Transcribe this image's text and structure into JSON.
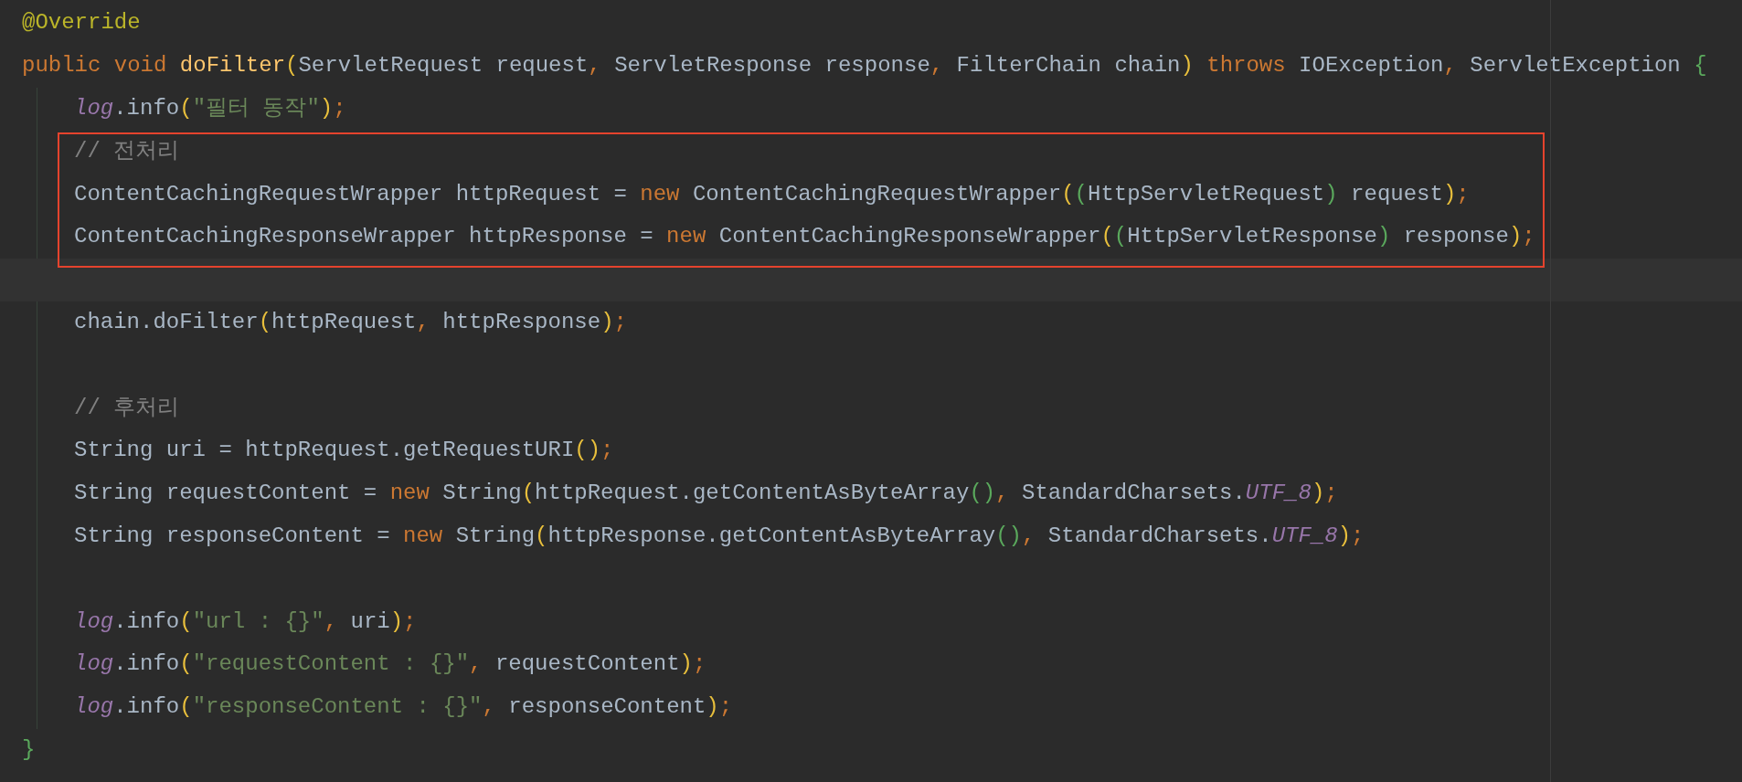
{
  "editor": {
    "lines": [
      {
        "kind": "line",
        "tokens": [
          {
            "kind": "annotation",
            "text": "@Override"
          }
        ]
      },
      {
        "kind": "line",
        "tokens": [
          {
            "kind": "keyword",
            "text": "public void "
          },
          {
            "kind": "method",
            "text": "doFilter"
          },
          {
            "kind": "bracket1",
            "text": "("
          },
          {
            "kind": "plain",
            "text": "ServletRequest request"
          },
          {
            "kind": "punct",
            "text": ", "
          },
          {
            "kind": "plain",
            "text": "ServletResponse response"
          },
          {
            "kind": "punct",
            "text": ", "
          },
          {
            "kind": "plain",
            "text": "FilterChain chain"
          },
          {
            "kind": "bracket1",
            "text": ")"
          },
          {
            "kind": "keyword",
            "text": " throws"
          },
          {
            "kind": "plain",
            "text": " IOException"
          },
          {
            "kind": "punct",
            "text": ", "
          },
          {
            "kind": "plain",
            "text": "ServletException "
          },
          {
            "kind": "bracket2",
            "text": "{"
          }
        ],
        "children": [
          {
            "kind": "line",
            "tokens": [
              {
                "kind": "field",
                "text": "log"
              },
              {
                "kind": "plain",
                "text": ".info"
              },
              {
                "kind": "bracket1",
                "text": "("
              },
              {
                "kind": "string",
                "text": "\"필터 동작\""
              },
              {
                "kind": "bracket1",
                "text": ")"
              },
              {
                "kind": "punct",
                "text": ";"
              }
            ]
          },
          {
            "kind": "box",
            "children": [
              {
                "kind": "line",
                "tokens": [
                  {
                    "kind": "comment",
                    "text": "// 전처리"
                  }
                ]
              },
              {
                "kind": "line",
                "tokens": [
                  {
                    "kind": "plain",
                    "text": "ContentCachingRequestWrapper httpRequest = "
                  },
                  {
                    "kind": "keyword",
                    "text": "new"
                  },
                  {
                    "kind": "plain",
                    "text": " ContentCachingRequestWrapper"
                  },
                  {
                    "kind": "bracket1",
                    "text": "("
                  },
                  {
                    "kind": "bracket2",
                    "text": "("
                  },
                  {
                    "kind": "plain",
                    "text": "HttpServletRequest"
                  },
                  {
                    "kind": "bracket2",
                    "text": ")"
                  },
                  {
                    "kind": "plain",
                    "text": " request"
                  },
                  {
                    "kind": "bracket1",
                    "text": ")"
                  },
                  {
                    "kind": "punct",
                    "text": ";"
                  }
                ]
              },
              {
                "kind": "line",
                "tokens": [
                  {
                    "kind": "plain",
                    "text": "ContentCachingResponseWrapper httpResponse = "
                  },
                  {
                    "kind": "keyword",
                    "text": "new"
                  },
                  {
                    "kind": "plain",
                    "text": " ContentCachingResponseWrapper"
                  },
                  {
                    "kind": "bracket1",
                    "text": "("
                  },
                  {
                    "kind": "bracket2",
                    "text": "("
                  },
                  {
                    "kind": "plain",
                    "text": "HttpServletResponse"
                  },
                  {
                    "kind": "bracket2",
                    "text": ")"
                  },
                  {
                    "kind": "plain",
                    "text": " response"
                  },
                  {
                    "kind": "bracket1",
                    "text": ")"
                  },
                  {
                    "kind": "punct",
                    "text": ";"
                  }
                ]
              }
            ]
          },
          {
            "kind": "blank",
            "current": true
          },
          {
            "kind": "line",
            "tokens": [
              {
                "kind": "plain",
                "text": "chain.doFilter"
              },
              {
                "kind": "bracket1",
                "text": "("
              },
              {
                "kind": "plain",
                "text": "httpRequest"
              },
              {
                "kind": "punct",
                "text": ", "
              },
              {
                "kind": "plain",
                "text": "httpResponse"
              },
              {
                "kind": "bracket1",
                "text": ")"
              },
              {
                "kind": "punct",
                "text": ";"
              }
            ]
          },
          {
            "kind": "blank"
          },
          {
            "kind": "line",
            "tokens": [
              {
                "kind": "comment",
                "text": "// 후처리"
              }
            ]
          },
          {
            "kind": "line",
            "tokens": [
              {
                "kind": "plain",
                "text": "String uri = httpRequest.getRequestURI"
              },
              {
                "kind": "bracket1",
                "text": "()"
              },
              {
                "kind": "punct",
                "text": ";"
              }
            ]
          },
          {
            "kind": "line",
            "tokens": [
              {
                "kind": "plain",
                "text": "String requestContent = "
              },
              {
                "kind": "keyword",
                "text": "new"
              },
              {
                "kind": "plain",
                "text": " String"
              },
              {
                "kind": "bracket1",
                "text": "("
              },
              {
                "kind": "plain",
                "text": "httpRequest.getContentAsByteArray"
              },
              {
                "kind": "bracket2",
                "text": "()"
              },
              {
                "kind": "punct",
                "text": ", "
              },
              {
                "kind": "plain",
                "text": "StandardCharsets."
              },
              {
                "kind": "field",
                "text": "UTF_8"
              },
              {
                "kind": "bracket1",
                "text": ")"
              },
              {
                "kind": "punct",
                "text": ";"
              }
            ]
          },
          {
            "kind": "line",
            "tokens": [
              {
                "kind": "plain",
                "text": "String responseContent = "
              },
              {
                "kind": "keyword",
                "text": "new"
              },
              {
                "kind": "plain",
                "text": " String"
              },
              {
                "kind": "bracket1",
                "text": "("
              },
              {
                "kind": "plain",
                "text": "httpResponse.getContentAsByteArray"
              },
              {
                "kind": "bracket2",
                "text": "()"
              },
              {
                "kind": "punct",
                "text": ", "
              },
              {
                "kind": "plain",
                "text": "StandardCharsets."
              },
              {
                "kind": "field",
                "text": "UTF_8"
              },
              {
                "kind": "bracket1",
                "text": ")"
              },
              {
                "kind": "punct",
                "text": ";"
              }
            ]
          },
          {
            "kind": "blank"
          },
          {
            "kind": "line",
            "tokens": [
              {
                "kind": "field",
                "text": "log"
              },
              {
                "kind": "plain",
                "text": ".info"
              },
              {
                "kind": "bracket1",
                "text": "("
              },
              {
                "kind": "string",
                "text": "\"url : {}\""
              },
              {
                "kind": "punct",
                "text": ", "
              },
              {
                "kind": "plain",
                "text": "uri"
              },
              {
                "kind": "bracket1",
                "text": ")"
              },
              {
                "kind": "punct",
                "text": ";"
              }
            ]
          },
          {
            "kind": "line",
            "tokens": [
              {
                "kind": "field",
                "text": "log"
              },
              {
                "kind": "plain",
                "text": ".info"
              },
              {
                "kind": "bracket1",
                "text": "("
              },
              {
                "kind": "string",
                "text": "\"requestContent : {}\""
              },
              {
                "kind": "punct",
                "text": ", "
              },
              {
                "kind": "plain",
                "text": "requestContent"
              },
              {
                "kind": "bracket1",
                "text": ")"
              },
              {
                "kind": "punct",
                "text": ";"
              }
            ]
          },
          {
            "kind": "line",
            "tokens": [
              {
                "kind": "field",
                "text": "log"
              },
              {
                "kind": "plain",
                "text": ".info"
              },
              {
                "kind": "bracket1",
                "text": "("
              },
              {
                "kind": "string",
                "text": "\"responseContent : {}\""
              },
              {
                "kind": "punct",
                "text": ", "
              },
              {
                "kind": "plain",
                "text": "responseContent"
              },
              {
                "kind": "bracket1",
                "text": ")"
              },
              {
                "kind": "punct",
                "text": ";"
              }
            ]
          }
        ]
      },
      {
        "kind": "line",
        "tokens": [
          {
            "kind": "bracket2",
            "text": "}"
          }
        ]
      }
    ]
  }
}
